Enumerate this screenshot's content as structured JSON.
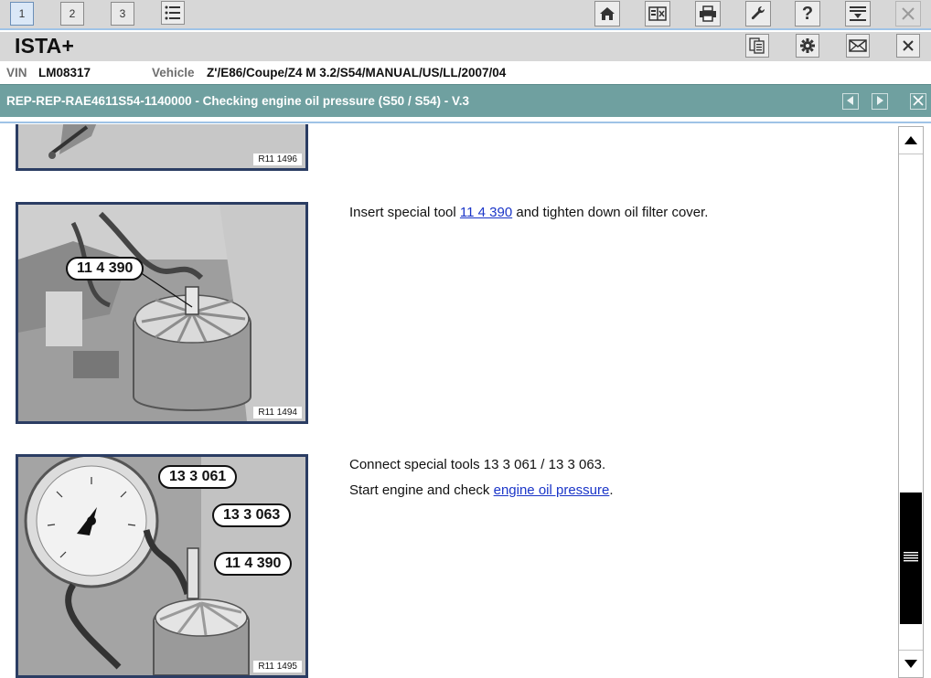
{
  "toolbar": {
    "tabs": [
      {
        "label": "1",
        "active": true
      },
      {
        "label": "2",
        "active": false
      },
      {
        "label": "3",
        "active": false
      }
    ],
    "icons": [
      "list-icon",
      "home-icon",
      "compare-icon",
      "print-icon",
      "wrench-icon",
      "help-icon",
      "download-icon",
      "close-icon"
    ]
  },
  "header": {
    "title": "ISTA+",
    "icons": [
      "documents-icon",
      "settings-icon",
      "mail-icon",
      "close-icon"
    ]
  },
  "vehicle": {
    "vin_label": "VIN",
    "vin_value": "LM08317",
    "vehicle_label": "Vehicle",
    "vehicle_value": "Z'/E86/Coupe/Z4 M 3.2/S54/MANUAL/US/LL/2007/04"
  },
  "document": {
    "title": "REP-REP-RAE4611S54-1140000 - Checking engine oil pressure (S50 / S54) - V.3",
    "nav": [
      "prev-icon",
      "next-icon",
      "close-icon"
    ]
  },
  "figures": [
    {
      "ref": "R11 1496"
    },
    {
      "ref": "R11 1494",
      "callouts": [
        "11 4 390"
      ]
    },
    {
      "ref": "R11 1495",
      "callouts": [
        "13 3 061",
        "13 3 063",
        "11 4 390"
      ]
    }
  ],
  "steps": {
    "step1": {
      "before": "Insert special tool ",
      "link": "11 4 390",
      "after": " and tighten down oil filter cover."
    },
    "step2_line1": "Connect special tools 13 3 061 / 13 3 063.",
    "step2_line2": {
      "before": "Start engine and check ",
      "link": "engine oil pressure",
      "after": "."
    }
  },
  "scrollbar": {
    "position_fraction": 0.93
  },
  "colors": {
    "toolbar_bg": "#d7d7d7",
    "doc_bar": "#6fa0a0",
    "link": "#1a35c8",
    "figure_frame": "#2b3d63",
    "accent_line": "#9fc3e6"
  }
}
